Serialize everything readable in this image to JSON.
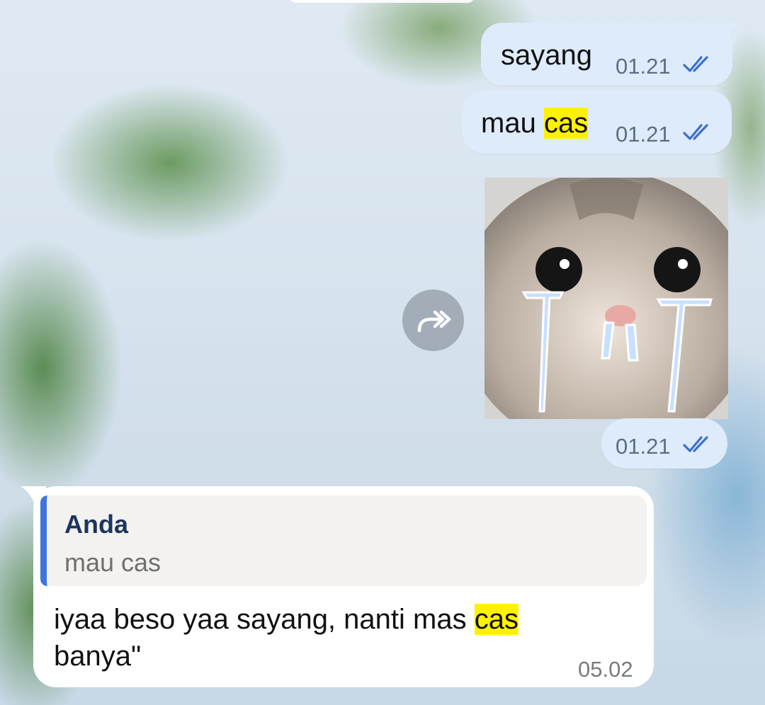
{
  "chat": {
    "messages_out": [
      {
        "id": "m1",
        "text": "sayang",
        "time": "01.21",
        "status": "read"
      },
      {
        "id": "m2",
        "text_before": "mau ",
        "text_highlight": "cas",
        "time": "01.21",
        "status": "read"
      },
      {
        "id": "m3",
        "type": "photo",
        "photo_desc": "crying cat sticker photo",
        "time": "01.21",
        "status": "read"
      }
    ],
    "message_in": {
      "reply_to": {
        "author": "Anda",
        "text": "mau cas"
      },
      "text_before": "iyaa beso yaa sayang, nanti mas ",
      "text_highlight": "cas",
      "text_after": "banya\"",
      "time": "05.02"
    }
  },
  "colors": {
    "outgoing_bubble": "#deebfb",
    "incoming_bubble": "#ffffff",
    "reply_bar": "#3d75dc",
    "reply_author": "#1c355e",
    "search_highlight": "#fff200",
    "read_ticks": "#3b6fc9"
  },
  "icons": {
    "forward": "forward-arrow-icon",
    "read_receipt": "double-check-icon"
  }
}
